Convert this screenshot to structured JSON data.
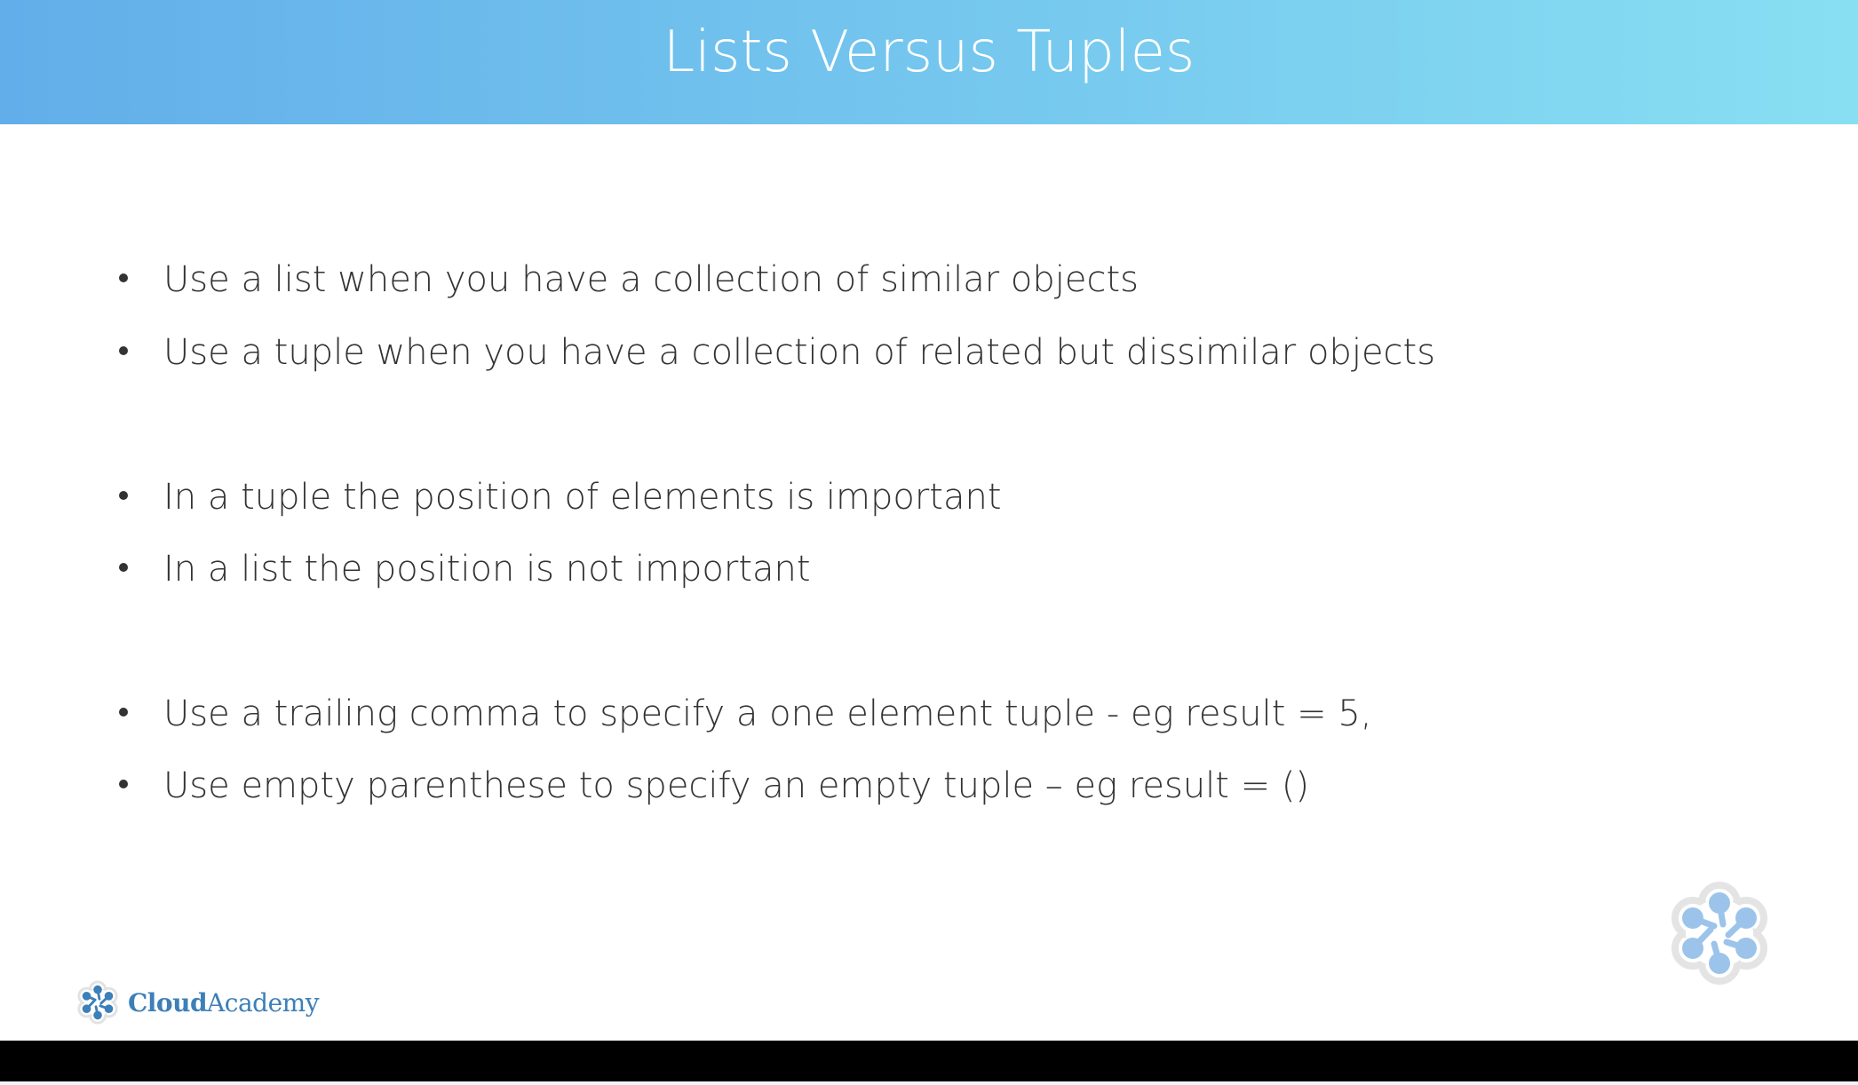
{
  "slide": {
    "title": "Lists Versus Tuples",
    "bullets": [
      "Use a list when you have a collection of similar objects",
      "Use a tuple when you have a collection of related but dissimilar objects",
      "In a tuple the position of elements is important",
      "In a list the position is not important",
      "Use a trailing comma to specify a one element tuple - eg result = 5,",
      "Use empty parenthese to specify an empty tuple – eg result = ()"
    ]
  },
  "brand": {
    "name_bold": "Cloud",
    "name_rest": "Academy"
  },
  "colors": {
    "header_start": "#62aeea",
    "header_end": "#88dff2",
    "brand": "#3d7fb8",
    "logo_light": "#9cc4ea"
  }
}
